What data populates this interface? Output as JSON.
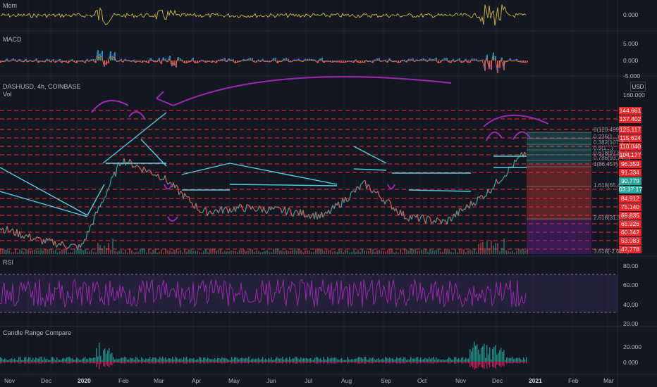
{
  "panes": {
    "mom": {
      "title": "Mom",
      "axis": [
        "0.000"
      ]
    },
    "macd": {
      "title": "MACD",
      "axis": [
        "5.000",
        "0.000",
        "-5.000"
      ]
    },
    "main": {
      "title": "DASHUSD, 4h, COINBASE",
      "vol_label": "Vol",
      "currency_button": "USD",
      "axis_top": "160.000"
    },
    "rsi": {
      "title": "RSI",
      "axis": [
        "80.00",
        "60.00",
        "40.00",
        "20.00"
      ]
    },
    "crc": {
      "title": "Candle Range Compare",
      "axis": [
        "20.000",
        "0.000"
      ]
    }
  },
  "price_levels": [
    "144.661",
    "137.402",
    "125.117",
    "115.624",
    "110.040",
    "104.177",
    "96.359",
    "91.334",
    "90.779",
    "03:37:17",
    "84.912",
    "75.140",
    "69.835",
    "65.926",
    "60.342",
    "53.083",
    "47.778"
  ],
  "fib_levels": [
    "0(120.499)",
    "0.236(1...)",
    "0.382(107.4...)",
    "0.5(1...)",
    "0.618(97.8...)",
    "0.786(93.74...)",
    "1(86.457)",
    "1.618(65.41...)",
    "2.618(31.37...)",
    "3.618(-2.66...)"
  ],
  "time_axis": [
    "Nov",
    "Dec",
    "2020",
    "Feb",
    "Mar",
    "Apr",
    "May",
    "Jun",
    "Jul",
    "Aug",
    "Sep",
    "Oct",
    "Nov",
    "Dec",
    "2021",
    "Feb",
    "Mar"
  ],
  "colors": {
    "background": "#131722",
    "up": "#26a69a",
    "down": "#ef5350",
    "level": "#ff2a2a",
    "trendline": "#4dd0e1",
    "annotation": "#9c27b0",
    "mom": "#c9b037",
    "rsi": "#9c27b0"
  },
  "chart_data": {
    "type": "line",
    "symbol": "DASHUSD",
    "interval": "4h",
    "exchange": "COINBASE",
    "x": [
      "Nov",
      "Dec",
      "2020",
      "Feb",
      "Mar",
      "Apr",
      "May",
      "Jun",
      "Jul",
      "Aug",
      "Sep",
      "Oct",
      "Nov",
      "Dec"
    ],
    "series": [
      {
        "name": "DASHUSD",
        "values": [
          64,
          55,
          50,
          112,
          100,
          75,
          78,
          76,
          72,
          95,
          72,
          68,
          88,
          118
        ]
      }
    ],
    "ylim": [
      47,
      160
    ],
    "current_price": 90.779,
    "countdown": "03:37:17"
  }
}
